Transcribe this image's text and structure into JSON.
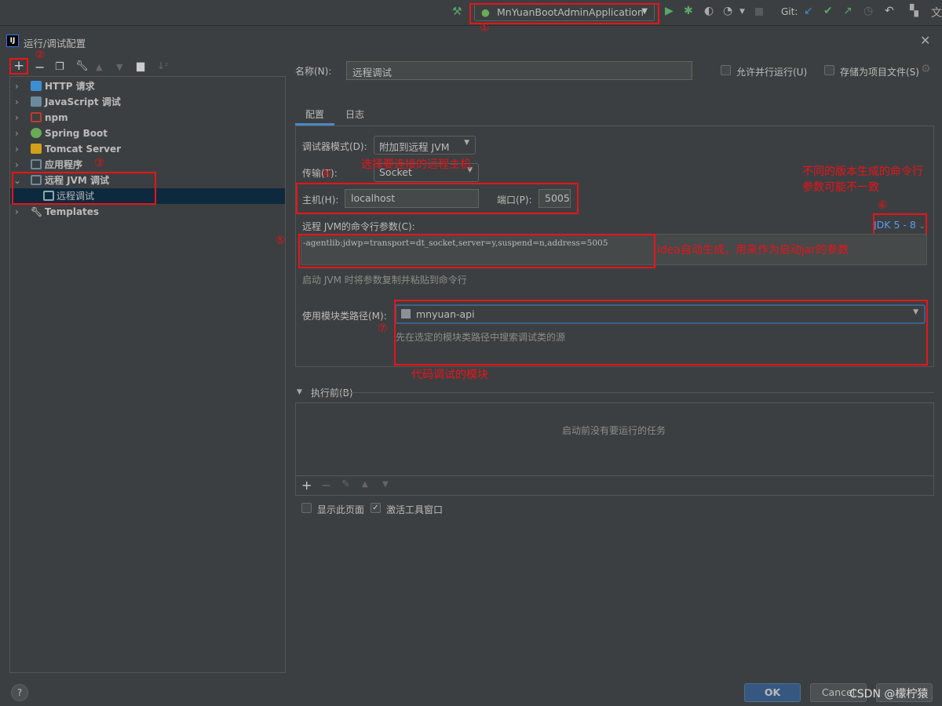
{
  "toolbar": {
    "run_config": "MnYuanBootAdminApplication",
    "git_label": "Git:"
  },
  "dialog": {
    "title": "运行/调试配置",
    "app_icon": "IJ"
  },
  "tree": {
    "items": [
      {
        "label": "HTTP 请求",
        "icon": "api-icon",
        "color": "#3d8fd1"
      },
      {
        "label": "JavaScript 调试",
        "icon": "javascript-debug-icon",
        "color": "#6b8a9e"
      },
      {
        "label": "npm",
        "icon": "npm-icon",
        "color": "#c0392b"
      },
      {
        "label": "Spring Boot",
        "icon": "spring-boot-icon",
        "color": "#6aab58"
      },
      {
        "label": "Tomcat Server",
        "icon": "tomcat-icon",
        "color": "#d4a017"
      },
      {
        "label": "应用程序",
        "icon": "application-icon",
        "color": "#6b8a9e"
      },
      {
        "label": "远程 JVM 调试",
        "icon": "remote-debug-icon",
        "color": "#6b8a9e",
        "expanded": true
      },
      {
        "label": "远程调试",
        "icon": "remote-debug-icon",
        "color": "#6b8a9e",
        "selected": true
      },
      {
        "label": "Templates",
        "icon": "wrench-icon",
        "color": "#aaaaaa"
      }
    ]
  },
  "form": {
    "name_label": "名称(N):",
    "name_value": "远程调试",
    "allow_parallel": "允许并行运行(U)",
    "store_as_file": "存储为项目文件(S)",
    "tabs": [
      "配置",
      "日志"
    ],
    "debugger_mode_label": "调试器模式(D):",
    "debugger_mode_value": "附加到远程 JVM",
    "transport_label": "传输(T):",
    "transport_value": "Socket",
    "host_label": "主机(H):",
    "host_value": "localhost",
    "port_label": "端口(P):",
    "port_value": "5005",
    "cmd_label": "远程 JVM的命令行参数(C):",
    "jdk_value": "JDK 5 - 8",
    "cmd_value": "-agentlib:jdwp=transport=dt_socket,server=y,suspend=n,address=5005",
    "cmd_hint": "启动 JVM 时将参数复制并粘贴到命令行",
    "module_label": "使用模块类路径(M):",
    "module_value": "mnyuan-api",
    "module_hint": "先在选定的模块类路径中搜索调试类的源",
    "before_label": "执行前(B)",
    "before_empty": "启动前没有要运行的任务",
    "show_page": "显示此页面",
    "activate_tool": "激活工具窗口",
    "activate_checked": true
  },
  "buttons": {
    "ok": "OK",
    "cancel": "Cancel",
    "help": "?"
  },
  "watermark": "CSDN @檬柠猿",
  "annotations": {
    "n1": "①",
    "n2": "②",
    "n3": "③",
    "n4": "④",
    "n5": "⑤",
    "n6": "⑥",
    "n7": "⑦",
    "select_host": "选择要连接的远程主机",
    "version_note_1": "不同的版本生成的命令行",
    "version_note_2": "参数可能不一致",
    "idea_generated": "idea自动生成，用来作为启动jar的参数",
    "module_note": "代码调试的模块"
  }
}
